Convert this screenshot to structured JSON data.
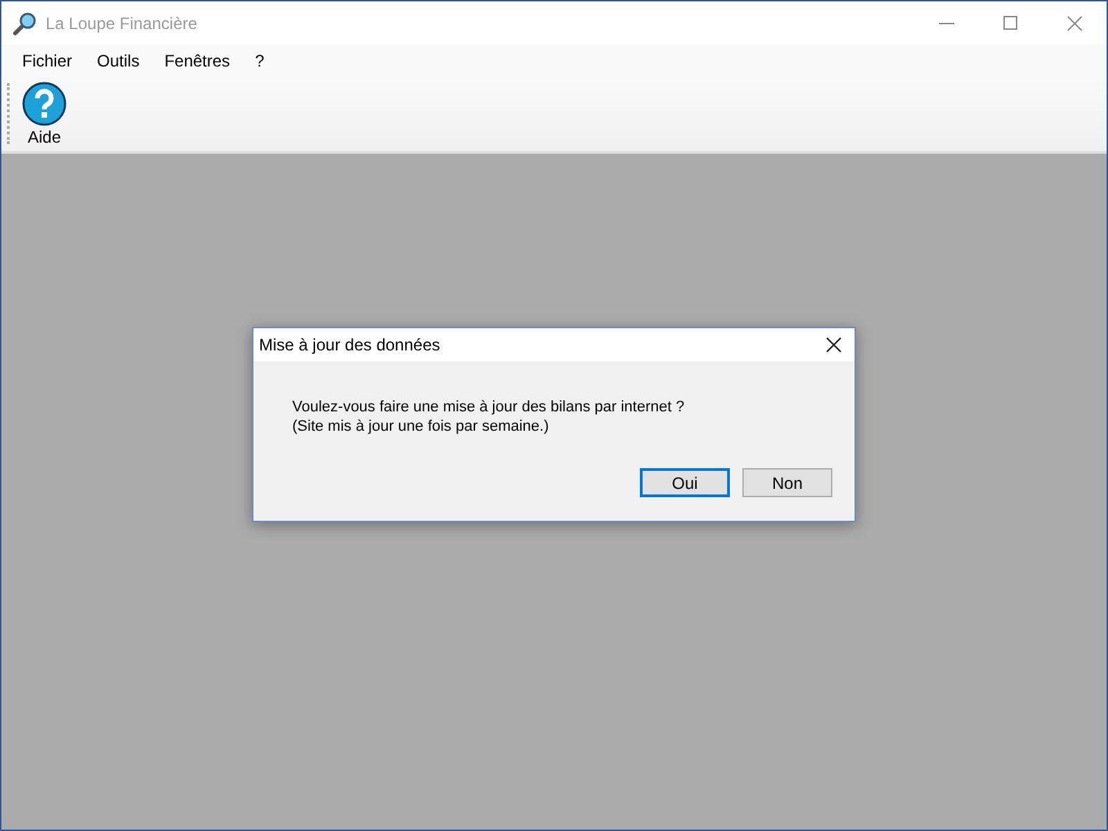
{
  "window": {
    "title": "La Loupe Financière"
  },
  "menu": [
    {
      "label": "Fichier"
    },
    {
      "label": "Outils"
    },
    {
      "label": "Fenêtres"
    },
    {
      "label": "?"
    }
  ],
  "toolbar": [
    {
      "label": "Aide"
    }
  ],
  "dialog": {
    "title": "Mise à jour des données",
    "message": [
      "Voulez-vous faire une mise à jour des bilans par internet ?",
      "(Site mis à jour une fois par semaine.)"
    ],
    "buttons": [
      {
        "label": "Oui",
        "default": true
      },
      {
        "label": "Non",
        "default": false
      }
    ]
  }
}
